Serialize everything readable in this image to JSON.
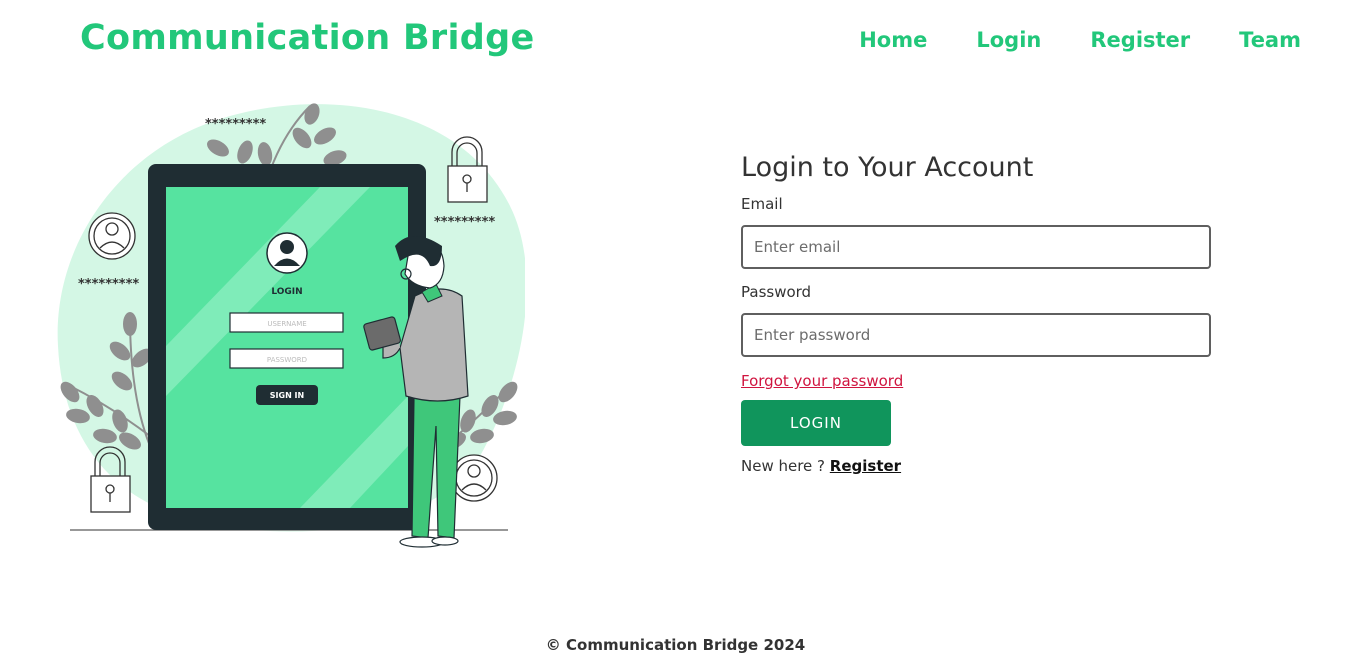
{
  "header": {
    "brand": "Communication Bridge",
    "nav": [
      {
        "label": "Home"
      },
      {
        "label": "Login"
      },
      {
        "label": "Register"
      },
      {
        "label": "Team"
      }
    ]
  },
  "illustration": {
    "masked_top": "*********",
    "masked_right": "*********",
    "masked_left": "*********",
    "screen_title": "LOGIN",
    "username_placeholder": "USERNAME",
    "password_placeholder": "PASSWORD",
    "sign_in": "SIGN IN"
  },
  "login": {
    "title": "Login to Your Account",
    "email_label": "Email",
    "email_placeholder": "Enter email",
    "email_value": "",
    "password_label": "Password",
    "password_placeholder": "Enter password",
    "password_value": "",
    "forgot_label": "Forgot your password",
    "submit_label": "LOGIN",
    "new_here_text": "New here ? ",
    "register_link": "Register"
  },
  "footer": {
    "text": "© Communication Bridge 2024"
  },
  "colors": {
    "brand": "#22c77a",
    "button": "#10955c",
    "forgot_link": "#d0143f",
    "illustration_blob": "#d4f7e5",
    "tablet_frame": "#1f2d33",
    "tablet_screen": "#56e3a0"
  }
}
